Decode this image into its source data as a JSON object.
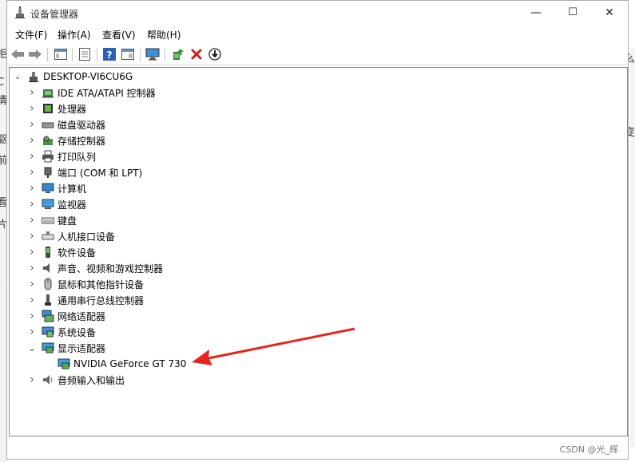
{
  "window": {
    "title": "设备管理器",
    "minimize": "—",
    "maximize": "☐",
    "close": "✕"
  },
  "menu": [
    "文件(F)",
    "操作(A)",
    "查看(V)",
    "帮助(H)"
  ],
  "toolbar": [
    "back",
    "forward",
    "properties-pane",
    "doc",
    "help",
    "view",
    "monitor",
    "update-driver",
    "uninstall",
    "download"
  ],
  "tree": {
    "root": "DESKTOP-VI6CU6G",
    "categories": [
      {
        "label": "IDE ATA/ATAPI 控制器",
        "icon": "ide-icon",
        "expanded": false
      },
      {
        "label": "处理器",
        "icon": "processor-icon",
        "expanded": false
      },
      {
        "label": "磁盘驱动器",
        "icon": "disk-icon",
        "expanded": false
      },
      {
        "label": "存储控制器",
        "icon": "storage-icon",
        "expanded": false
      },
      {
        "label": "打印队列",
        "icon": "printer-icon",
        "expanded": false
      },
      {
        "label": "端口 (COM 和 LPT)",
        "icon": "port-icon",
        "expanded": false
      },
      {
        "label": "计算机",
        "icon": "computer-icon",
        "expanded": false
      },
      {
        "label": "监视器",
        "icon": "monitor-icon",
        "expanded": false
      },
      {
        "label": "键盘",
        "icon": "keyboard-icon",
        "expanded": false
      },
      {
        "label": "人机接口设备",
        "icon": "hid-icon",
        "expanded": false
      },
      {
        "label": "软件设备",
        "icon": "software-icon",
        "expanded": false
      },
      {
        "label": "声音、视频和游戏控制器",
        "icon": "sound-icon",
        "expanded": false
      },
      {
        "label": "鼠标和其他指针设备",
        "icon": "mouse-icon",
        "expanded": false
      },
      {
        "label": "通用串行总线控制器",
        "icon": "usb-icon",
        "expanded": false
      },
      {
        "label": "网络适配器",
        "icon": "network-icon",
        "expanded": false
      },
      {
        "label": "系统设备",
        "icon": "system-icon",
        "expanded": false
      },
      {
        "label": "显示适配器",
        "icon": "display-icon",
        "expanded": true
      },
      {
        "label": "音频输入和输出",
        "icon": "audio-icon",
        "expanded": false
      }
    ],
    "display_child": "NVIDIA GeForce GT 730"
  },
  "watermark": "CSDN @光_辉",
  "background_chars": {
    "left": [
      "拒",
      "C",
      "情",
      "驱",
      "前",
      "看",
      "片",
      "/"
    ],
    "right": [
      "么",
      "变"
    ]
  },
  "colors": {
    "arrow": "#e8241c",
    "tree_border": "#828790"
  }
}
